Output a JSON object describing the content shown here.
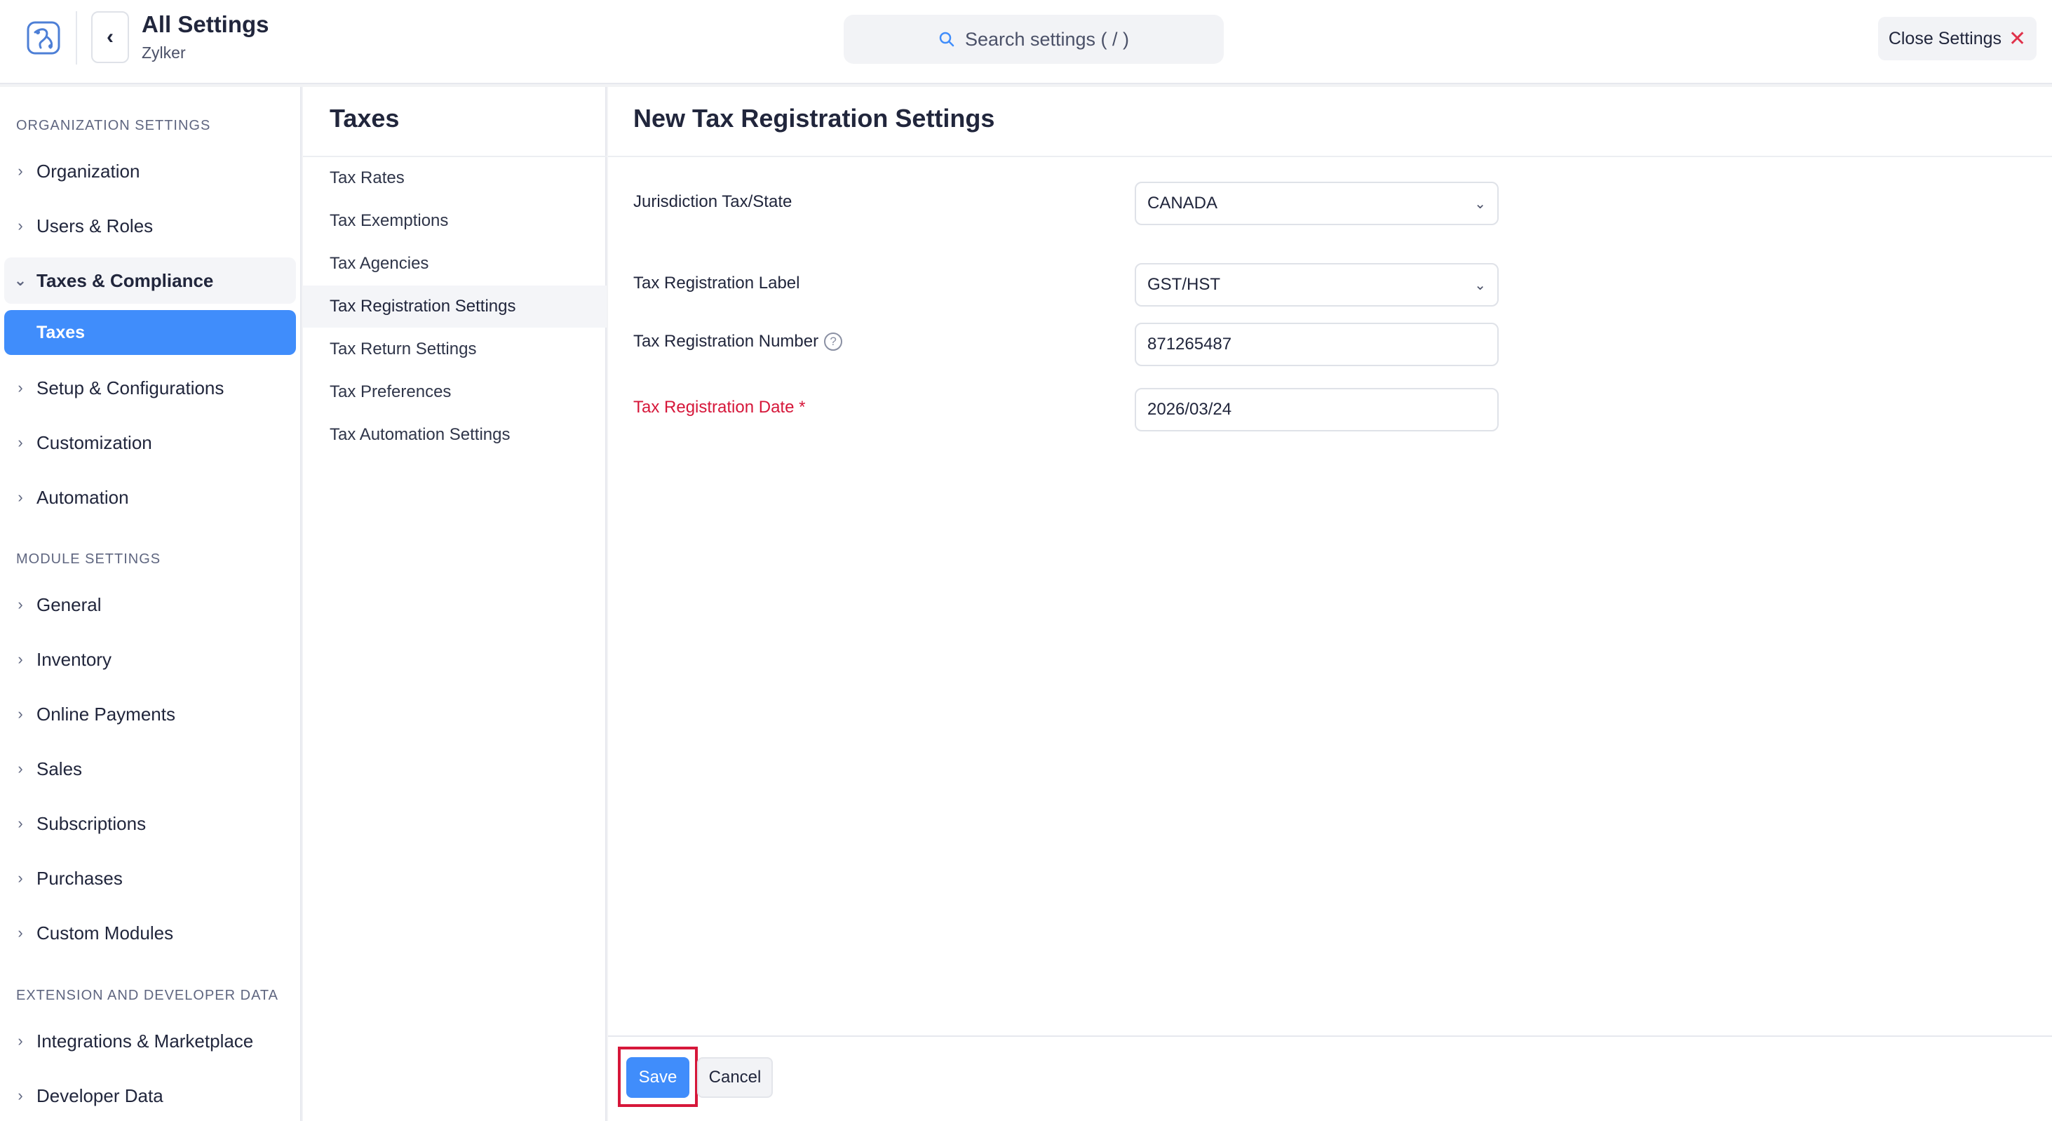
{
  "header": {
    "title": "All Settings",
    "subtitle": "Zylker",
    "search_placeholder": "Search settings ( / )",
    "close_label": "Close Settings",
    "close_icon": "close-icon"
  },
  "sidebar": {
    "org_heading": "ORGANIZATION SETTINGS",
    "org_items": [
      {
        "label": "Organization"
      },
      {
        "label": "Users & Roles"
      },
      {
        "label": "Taxes & Compliance",
        "expanded": true
      },
      {
        "label": "Setup & Configurations"
      },
      {
        "label": "Customization"
      },
      {
        "label": "Automation"
      }
    ],
    "active_sub": "Taxes",
    "module_heading": "MODULE SETTINGS",
    "module_items": [
      {
        "label": "General"
      },
      {
        "label": "Inventory"
      },
      {
        "label": "Online Payments"
      },
      {
        "label": "Sales"
      },
      {
        "label": "Subscriptions"
      },
      {
        "label": "Purchases"
      },
      {
        "label": "Custom Modules"
      }
    ],
    "ext_heading": "EXTENSION AND DEVELOPER DATA",
    "ext_items": [
      {
        "label": "Integrations & Marketplace"
      },
      {
        "label": "Developer Data"
      }
    ]
  },
  "middle": {
    "title": "Taxes",
    "items": [
      {
        "label": "Tax Rates"
      },
      {
        "label": "Tax Exemptions"
      },
      {
        "label": "Tax Agencies"
      },
      {
        "label": "Tax Registration Settings",
        "active": true
      },
      {
        "label": "Tax Return Settings"
      },
      {
        "label": "Tax Preferences"
      },
      {
        "label": "Tax Automation Settings"
      }
    ]
  },
  "main": {
    "title": "New Tax Registration Settings",
    "fields": {
      "jurisdiction_label": "Jurisdiction Tax/State",
      "jurisdiction_value": "CANADA",
      "reg_label_label": "Tax Registration Label",
      "reg_label_value": "GST/HST",
      "reg_number_label": "Tax Registration Number",
      "reg_number_value": "871265487",
      "reg_date_label": "Tax Registration Date *",
      "reg_date_value": "2026/03/24"
    },
    "save_label": "Save",
    "cancel_label": "Cancel"
  },
  "colors": {
    "accent": "#408dfb",
    "required": "#d6173a"
  }
}
